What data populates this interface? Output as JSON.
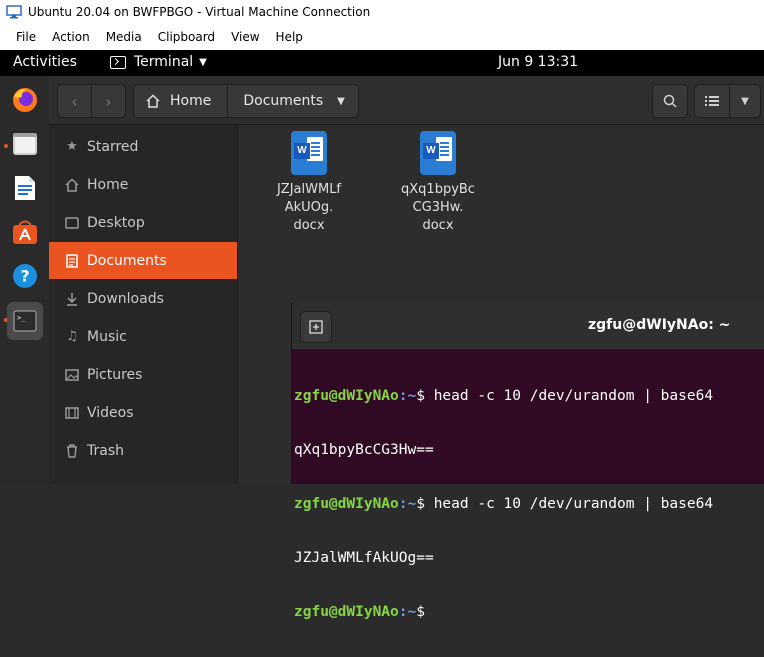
{
  "window": {
    "title": "Ubuntu 20.04 on BWFPBGO - Virtual Machine Connection",
    "menu": [
      "File",
      "Action",
      "Media",
      "Clipboard",
      "View",
      "Help"
    ]
  },
  "topbar": {
    "activities": "Activities",
    "app_name": "Terminal",
    "clock": "Jun 9  13:31"
  },
  "dock": {
    "items": [
      "firefox-icon",
      "files-icon",
      "writer-icon",
      "software-icon",
      "help-icon",
      "terminal-icon"
    ],
    "accent": "#e95420"
  },
  "files": {
    "path": [
      "Home",
      "Documents"
    ],
    "sidebar": [
      {
        "label": "Starred",
        "icon": "star-icon"
      },
      {
        "label": "Home",
        "icon": "home-icon"
      },
      {
        "label": "Desktop",
        "icon": "desktop-icon"
      },
      {
        "label": "Documents",
        "icon": "document-icon",
        "selected": true
      },
      {
        "label": "Downloads",
        "icon": "download-icon"
      },
      {
        "label": "Music",
        "icon": "music-icon"
      },
      {
        "label": "Pictures",
        "icon": "picture-icon"
      },
      {
        "label": "Videos",
        "icon": "video-icon"
      },
      {
        "label": "Trash",
        "icon": "trash-icon"
      }
    ],
    "items": [
      {
        "name_lines": [
          "JZJalWMLf",
          "AkUOg.",
          "docx"
        ]
      },
      {
        "name_lines": [
          "qXq1bpyBc",
          "CG3Hw.",
          "docx"
        ]
      }
    ]
  },
  "terminal": {
    "title": "zgfu@dWIyNAo: ~",
    "lines": [
      {
        "user": "zgfu@dWIyNAo",
        "path": "~",
        "cmd": "$ head -c 10 /dev/urandom | base64"
      },
      {
        "output": "qXq1bpyBcCG3Hw=="
      },
      {
        "user": "zgfu@dWIyNAo",
        "path": "~",
        "cmd": "$ head -c 10 /dev/urandom | base64"
      },
      {
        "output": "JZJalWMLfAkUOg=="
      },
      {
        "user": "zgfu@dWIyNAo",
        "path": "~",
        "cmd": "$"
      }
    ]
  }
}
